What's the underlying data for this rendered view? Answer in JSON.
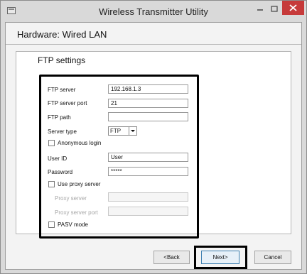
{
  "window": {
    "title": "Wireless Transmitter Utility",
    "controls": {
      "minimize": "–",
      "maximize": "☐",
      "close": "✕"
    }
  },
  "header": {
    "heading": "Hardware: Wired LAN"
  },
  "ftp": {
    "section_title": "FTP settings",
    "server_label": "FTP server",
    "server_value": "192.168.1.3",
    "port_label": "FTP server port",
    "port_value": "21",
    "path_label": "FTP path",
    "path_value": "",
    "server_type_label": "Server type",
    "server_type_value": "FTP",
    "anonymous_label": "Anonymous login",
    "anonymous_checked": false,
    "userid_label": "User ID",
    "userid_value": "User",
    "password_label": "Password",
    "password_value": "*****",
    "proxy_label": "Use proxy server",
    "proxy_checked": false,
    "proxy_server_label": "Proxy server",
    "proxy_server_value": "",
    "proxy_port_label": "Proxy server port",
    "proxy_port_value": "",
    "pasv_label": "PASV mode",
    "pasv_checked": false
  },
  "buttons": {
    "back": "<Back",
    "next": "Next>",
    "cancel": "Cancel"
  },
  "colors": {
    "close_button": "#c63a3a",
    "highlight_border": "#000000",
    "default_button_border": "#3c7fb1"
  }
}
